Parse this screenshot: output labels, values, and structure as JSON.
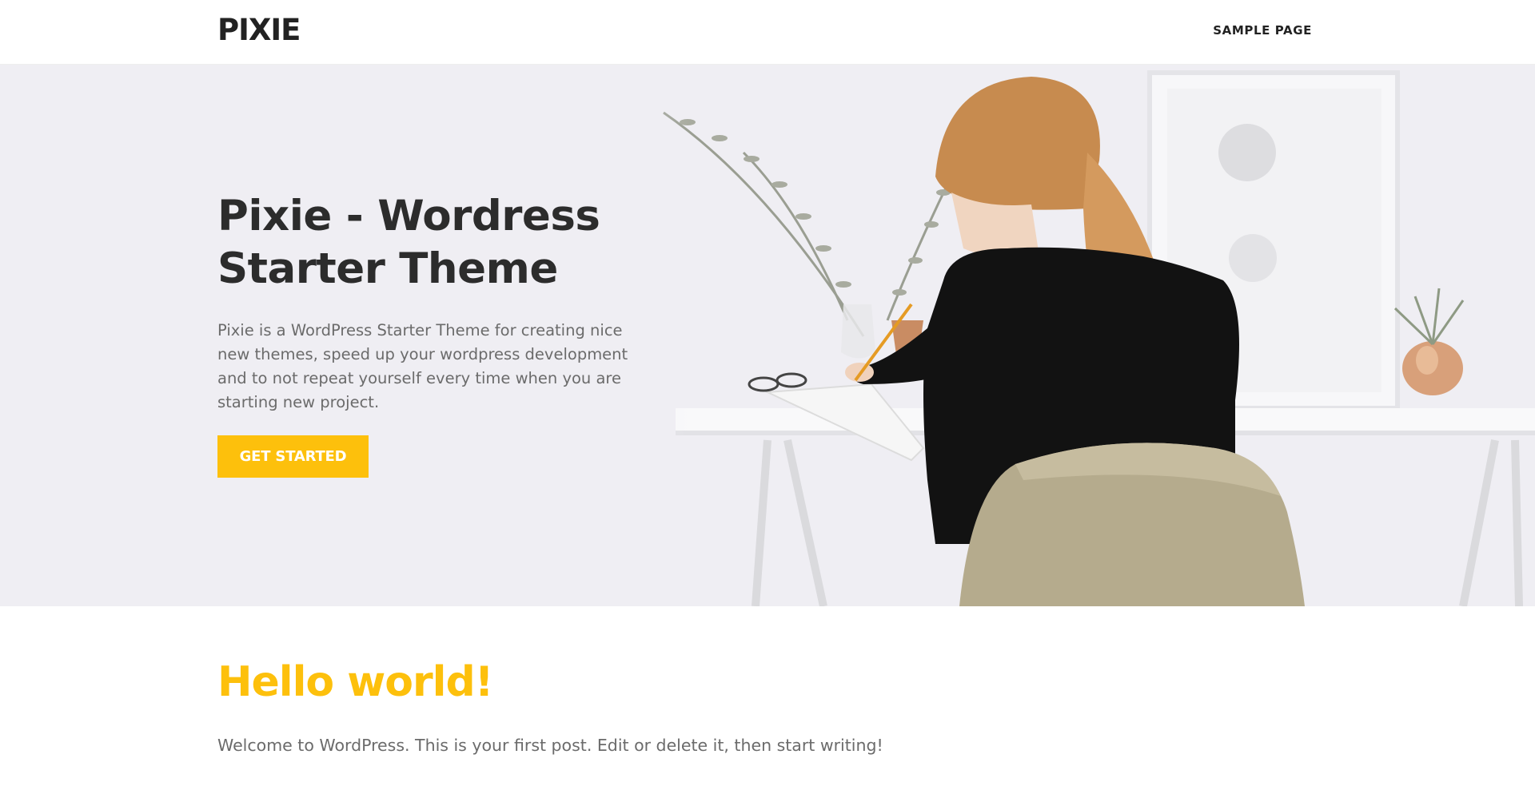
{
  "header": {
    "logo": "PIXIE",
    "nav": [
      "SAMPLE PAGE"
    ]
  },
  "hero": {
    "title_line1": "Pixie - Wordress",
    "title_line2": "Starter Theme",
    "description": "Pixie is a WordPress Starter Theme for creating nice new themes, speed up your wordpress development and to not repeat yourself every time when you are starting new project.",
    "cta_label": "GET STARTED",
    "image_subject": "woman-writing-at-desk-photo"
  },
  "post": {
    "title": "Hello world!",
    "excerpt": "Welcome to WordPress. This is your first post. Edit or delete it, then start writing!"
  },
  "colors": {
    "accent": "#fdc00c",
    "text_dark": "#2c2c2c",
    "text_muted": "#6b6b6b",
    "hero_bg": "#efeef3"
  }
}
